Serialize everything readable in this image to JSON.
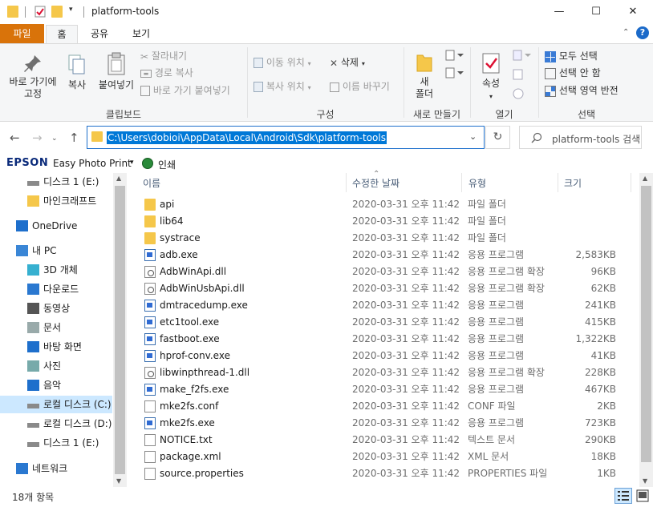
{
  "window": {
    "title": "platform-tools",
    "min_label": "—",
    "max_label": "☐",
    "close_label": "✕"
  },
  "quick_access": {
    "dropdown": "▾"
  },
  "tabs": {
    "file": "파일",
    "home": "홈",
    "share": "공유",
    "view": "보기"
  },
  "ribbon": {
    "pin": "바로 가기에\n고정",
    "pin_line1": "바로 가기에",
    "pin_line2": "고정",
    "copy": "복사",
    "paste": "붙여넣기",
    "cut": "잘라내기",
    "copy_path": "경로 복사",
    "paste_shortcut": "바로 가기 붙여넣기",
    "clipboard_group": "클립보드",
    "move_to": "이동 위치",
    "copy_to": "복사 위치",
    "delete": "삭제",
    "rename": "이름 바꾸기",
    "organize_group": "구성",
    "new_folder_line1": "새",
    "new_folder_line2": "폴더",
    "new_group": "새로 만들기",
    "properties": "속성",
    "open_group": "열기",
    "select_all": "모두 선택",
    "select_none": "선택 안 함",
    "invert_selection": "선택 영역 반전",
    "select_group": "선택"
  },
  "address": {
    "path": "C:\\Users\\dobioi\\AppData\\Local\\Android\\Sdk\\platform-tools",
    "search_placeholder": "platform-tools 검색"
  },
  "epson": {
    "logo": "EPSON",
    "app": "Easy Photo Print",
    "print": "인쇄"
  },
  "nav": [
    {
      "label": "디스크 1 (E:)",
      "icon": "drive-icon"
    },
    {
      "label": "마인크래프트",
      "icon": "folder-icon"
    },
    {
      "label": "OneDrive",
      "icon": "onedrive-icon"
    },
    {
      "label": "내 PC",
      "icon": "pc-icon"
    },
    {
      "label": "3D 개체",
      "icon": "3d-objects-icon"
    },
    {
      "label": "다운로드",
      "icon": "download-icon"
    },
    {
      "label": "동영상",
      "icon": "video-icon"
    },
    {
      "label": "문서",
      "icon": "document-icon"
    },
    {
      "label": "바탕 화면",
      "icon": "desktop-icon"
    },
    {
      "label": "사진",
      "icon": "pictures-icon"
    },
    {
      "label": "음악",
      "icon": "music-icon"
    },
    {
      "label": "로컬 디스크 (C:)",
      "icon": "drive-icon"
    },
    {
      "label": "로컬 디스크 (D:)",
      "icon": "drive-icon"
    },
    {
      "label": "디스크 1 (E:)",
      "icon": "drive-icon"
    },
    {
      "label": "네트워크",
      "icon": "network-icon"
    }
  ],
  "columns": {
    "name": "이름",
    "date": "수정한 날짜",
    "type": "유형",
    "size": "크기"
  },
  "files": [
    {
      "name": "api",
      "date": "2020-03-31 오후 11:42",
      "type": "파일 폴더",
      "size": "",
      "icon": "folder-icon"
    },
    {
      "name": "lib64",
      "date": "2020-03-31 오후 11:42",
      "type": "파일 폴더",
      "size": "",
      "icon": "folder-icon"
    },
    {
      "name": "systrace",
      "date": "2020-03-31 오후 11:42",
      "type": "파일 폴더",
      "size": "",
      "icon": "folder-icon"
    },
    {
      "name": "adb.exe",
      "date": "2020-03-31 오후 11:42",
      "type": "응용 프로그램",
      "size": "2,583KB",
      "icon": "exe-icon"
    },
    {
      "name": "AdbWinApi.dll",
      "date": "2020-03-31 오후 11:42",
      "type": "응용 프로그램 확장",
      "size": "96KB",
      "icon": "dll-icon"
    },
    {
      "name": "AdbWinUsbApi.dll",
      "date": "2020-03-31 오후 11:42",
      "type": "응용 프로그램 확장",
      "size": "62KB",
      "icon": "dll-icon"
    },
    {
      "name": "dmtracedump.exe",
      "date": "2020-03-31 오후 11:42",
      "type": "응용 프로그램",
      "size": "241KB",
      "icon": "exe-icon"
    },
    {
      "name": "etc1tool.exe",
      "date": "2020-03-31 오후 11:42",
      "type": "응용 프로그램",
      "size": "415KB",
      "icon": "exe-icon"
    },
    {
      "name": "fastboot.exe",
      "date": "2020-03-31 오후 11:42",
      "type": "응용 프로그램",
      "size": "1,322KB",
      "icon": "exe-icon"
    },
    {
      "name": "hprof-conv.exe",
      "date": "2020-03-31 오후 11:42",
      "type": "응용 프로그램",
      "size": "41KB",
      "icon": "exe-icon"
    },
    {
      "name": "libwinpthread-1.dll",
      "date": "2020-03-31 오후 11:42",
      "type": "응용 프로그램 확장",
      "size": "228KB",
      "icon": "dll-icon"
    },
    {
      "name": "make_f2fs.exe",
      "date": "2020-03-31 오후 11:42",
      "type": "응용 프로그램",
      "size": "467KB",
      "icon": "exe-icon"
    },
    {
      "name": "mke2fs.conf",
      "date": "2020-03-31 오후 11:42",
      "type": "CONF 파일",
      "size": "2KB",
      "icon": "file-icon"
    },
    {
      "name": "mke2fs.exe",
      "date": "2020-03-31 오후 11:42",
      "type": "응용 프로그램",
      "size": "723KB",
      "icon": "exe-icon"
    },
    {
      "name": "NOTICE.txt",
      "date": "2020-03-31 오후 11:42",
      "type": "텍스트 문서",
      "size": "290KB",
      "icon": "text-file-icon"
    },
    {
      "name": "package.xml",
      "date": "2020-03-31 오후 11:42",
      "type": "XML 문서",
      "size": "18KB",
      "icon": "xml-file-icon"
    },
    {
      "name": "source.properties",
      "date": "2020-03-31 오후 11:42",
      "type": "PROPERTIES 파일",
      "size": "1KB",
      "icon": "file-icon"
    }
  ],
  "status": {
    "count": "18개 항목"
  },
  "colors": {
    "file_tab": "#d9730a",
    "selection": "#0078d7",
    "nav_selected": "#cce8ff",
    "folder": "#f5c74a"
  }
}
